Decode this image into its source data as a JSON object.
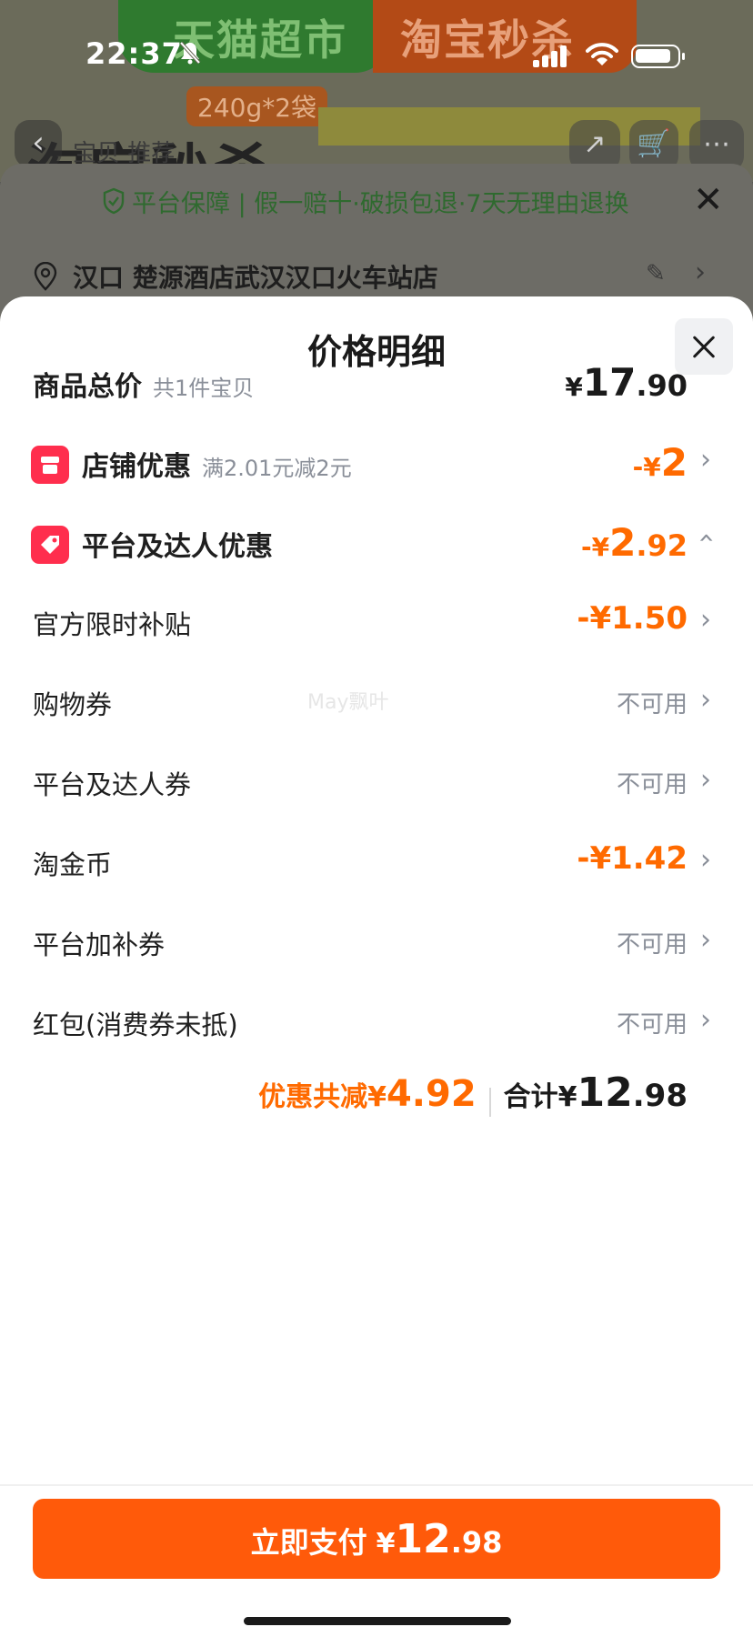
{
  "status_bar": {
    "time": "22:37"
  },
  "background": {
    "banner_left": "天猫超市",
    "banner_right": "淘宝秒杀",
    "tag": "240g*2袋",
    "title": "淘宝秒杀",
    "subtitle": "宝贝 推荐",
    "guarantee_text": "平台保障 | 假一赔十·破损包退·7天无理由退换",
    "address": "汉口 楚源酒店武汉汉口火车站店"
  },
  "sheet": {
    "title": "价格明细",
    "total": {
      "label": "商品总价",
      "sub": "共1件宝贝",
      "yen": "¥",
      "int": "17",
      "dec": ".90"
    },
    "shop": {
      "label": "店铺优惠",
      "sub": "满2.01元减2元",
      "prefix": "-¥",
      "int": "2"
    },
    "platform": {
      "label": "平台及达人优惠",
      "prefix": "-¥",
      "int": "2",
      "dec": ".92"
    },
    "items": [
      {
        "label": "官方限时补贴",
        "value": "-¥1.50"
      },
      {
        "label": "购物券",
        "value": "不可用"
      },
      {
        "label": "平台及达人券",
        "value": "不可用"
      },
      {
        "label": "淘金币",
        "value": "-¥1.42"
      },
      {
        "label": "平台加补券",
        "value": "不可用"
      },
      {
        "label": "红包(消费券未抵)",
        "value": "不可用"
      }
    ],
    "discount_label": "优惠共减¥",
    "discount_value": "4.92",
    "sum_label": "合计¥",
    "sum_int": "12",
    "sum_dec": ".98",
    "watermark": "May飘叶",
    "pay_label": "立即支付",
    "pay_yen": "¥",
    "pay_int": "12",
    "pay_dec": ".98"
  },
  "colors": {
    "accent": "#ff6a00",
    "pay_button": "#ff5a0a",
    "shop_icon": "#ff2e4d"
  }
}
